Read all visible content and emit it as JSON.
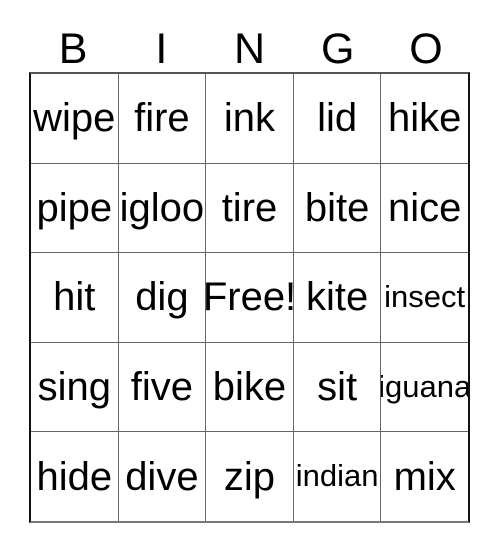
{
  "card": {
    "headers": [
      "B",
      "I",
      "N",
      "G",
      "O"
    ],
    "rows": [
      [
        {
          "text": "wipe",
          "size": "normal"
        },
        {
          "text": "fire",
          "size": "normal"
        },
        {
          "text": "ink",
          "size": "normal"
        },
        {
          "text": "lid",
          "size": "normal"
        },
        {
          "text": "hike",
          "size": "normal"
        }
      ],
      [
        {
          "text": "pipe",
          "size": "normal"
        },
        {
          "text": "igloo",
          "size": "normal"
        },
        {
          "text": "tire",
          "size": "normal"
        },
        {
          "text": "bite",
          "size": "normal"
        },
        {
          "text": "nice",
          "size": "normal"
        }
      ],
      [
        {
          "text": "hit",
          "size": "normal"
        },
        {
          "text": "dig",
          "size": "normal"
        },
        {
          "text": "Free!",
          "size": "free"
        },
        {
          "text": "kite",
          "size": "normal"
        },
        {
          "text": "insect",
          "size": "shrink"
        }
      ],
      [
        {
          "text": "sing",
          "size": "normal"
        },
        {
          "text": "five",
          "size": "normal"
        },
        {
          "text": "bike",
          "size": "normal"
        },
        {
          "text": "sit",
          "size": "normal"
        },
        {
          "text": "iguana",
          "size": "shrink"
        }
      ],
      [
        {
          "text": "hide",
          "size": "normal"
        },
        {
          "text": "dive",
          "size": "normal"
        },
        {
          "text": "zip",
          "size": "normal"
        },
        {
          "text": "indian",
          "size": "shrink"
        },
        {
          "text": "mix",
          "size": "normal"
        }
      ]
    ],
    "colors": {
      "text": "#000000",
      "background": "#ffffff",
      "grid_line": "#666666",
      "outer_border": "#111111"
    }
  }
}
